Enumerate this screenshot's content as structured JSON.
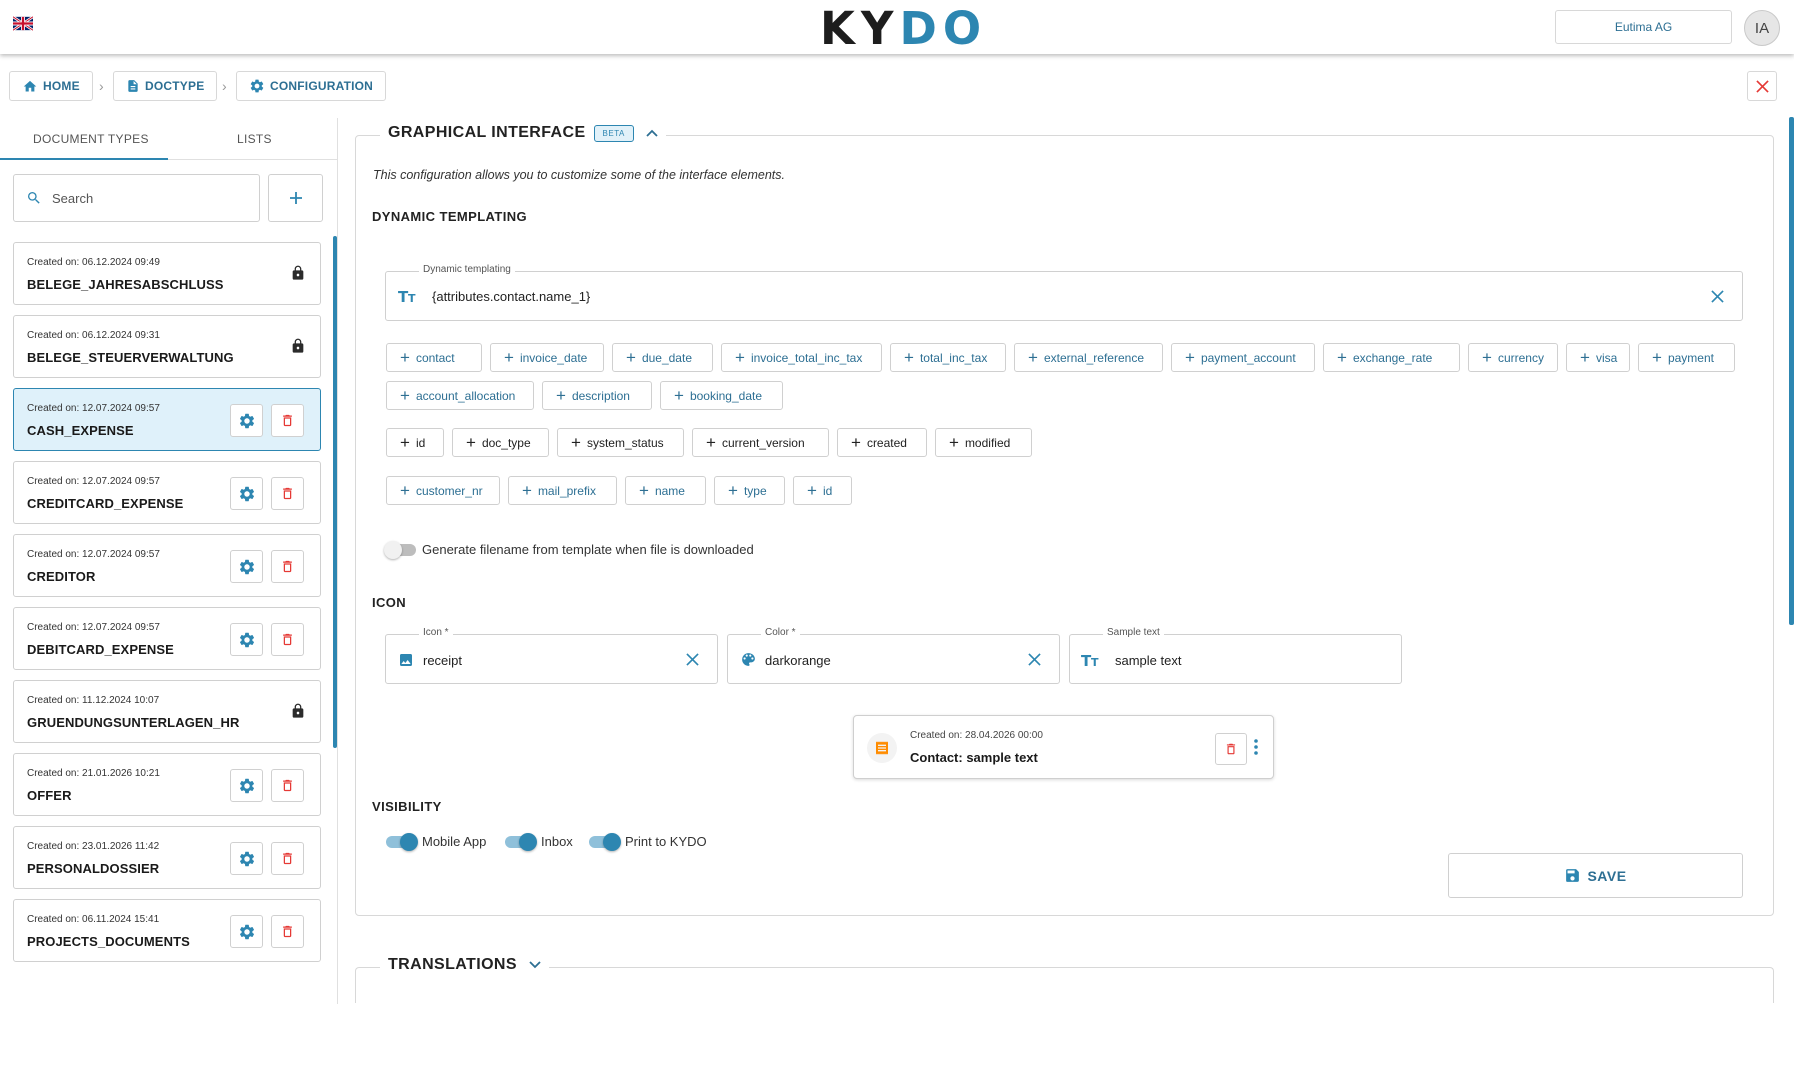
{
  "header": {
    "logo_k": "K",
    "logo_y": "Y",
    "logo_d": "D",
    "logo_o": "O",
    "company": "Eutima AG",
    "avatar": "IA"
  },
  "breadcrumb": {
    "home": "HOME",
    "doctype": "DOCTYPE",
    "configuration": "CONFIGURATION"
  },
  "sidebar": {
    "tab_document_types": "DOCUMENT TYPES",
    "tab_lists": "LISTS",
    "search_placeholder": "Search",
    "items": [
      {
        "date": "Created on: 06.12.2024 09:49",
        "name": "BELEGE_JAHRESABSCHLUSS",
        "locked": true
      },
      {
        "date": "Created on: 06.12.2024 09:31",
        "name": "BELEGE_STEUERVERWALTUNG",
        "locked": true
      },
      {
        "date": "Created on: 12.07.2024 09:57",
        "name": "CASH_EXPENSE",
        "locked": false,
        "selected": true
      },
      {
        "date": "Created on: 12.07.2024 09:57",
        "name": "CREDITCARD_EXPENSE",
        "locked": false
      },
      {
        "date": "Created on: 12.07.2024 09:57",
        "name": "CREDITOR",
        "locked": false
      },
      {
        "date": "Created on: 12.07.2024 09:57",
        "name": "DEBITCARD_EXPENSE",
        "locked": false
      },
      {
        "date": "Created on: 11.12.2024 10:07",
        "name": "GRUENDUNGSUNTERLAGEN_HR",
        "locked": true
      },
      {
        "date": "Created on: 21.01.2026 10:21",
        "name": "OFFER",
        "locked": false
      },
      {
        "date": "Created on: 23.01.2026 11:42",
        "name": "PERSONALDOSSIER",
        "locked": false
      },
      {
        "date": "Created on: 06.11.2024 15:41",
        "name": "PROJECTS_DOCUMENTS",
        "locked": false
      }
    ]
  },
  "graphical_interface": {
    "title": "GRAPHICAL INTERFACE",
    "badge": "BETA",
    "description": "This configuration allows you to customize some of the interface elements.",
    "dynamic_templating": {
      "heading": "DYNAMIC TEMPLATING",
      "field_label": "Dynamic templating",
      "field_value": "{attributes.contact.name_1}",
      "chips_row1": [
        "contact",
        "invoice_date",
        "due_date",
        "invoice_total_inc_tax",
        "total_inc_tax",
        "external_reference",
        "payment_account",
        "exchange_rate",
        "currency",
        "visa",
        "payment"
      ],
      "chips_row2": [
        "account_allocation",
        "description",
        "booking_date"
      ],
      "chips_row3": [
        "id",
        "doc_type",
        "system_status",
        "current_version",
        "created",
        "modified"
      ],
      "chips_row4": [
        "customer_nr",
        "mail_prefix",
        "name",
        "type",
        "id"
      ],
      "filename_toggle_label": "Generate filename from template when file is downloaded",
      "filename_toggle_on": false
    },
    "icon": {
      "heading": "ICON",
      "icon_label": "Icon *",
      "icon_value": "receipt",
      "color_label": "Color *",
      "color_value": "darkorange",
      "sample_label": "Sample text",
      "sample_value": "sample text",
      "preview_date": "Created on: 28.04.2026 00:00",
      "preview_title": "Contact: sample text"
    },
    "visibility": {
      "heading": "VISIBILITY",
      "toggles": [
        {
          "label": "Mobile App",
          "on": true
        },
        {
          "label": "Inbox",
          "on": true
        },
        {
          "label": "Print to KYDO",
          "on": true
        }
      ]
    },
    "save_label": "SAVE"
  },
  "translations": {
    "title": "TRANSLATIONS"
  },
  "colors": {
    "accent": "#2d86b1",
    "danger": "#e53935",
    "icon_color": "#ff8c00"
  }
}
